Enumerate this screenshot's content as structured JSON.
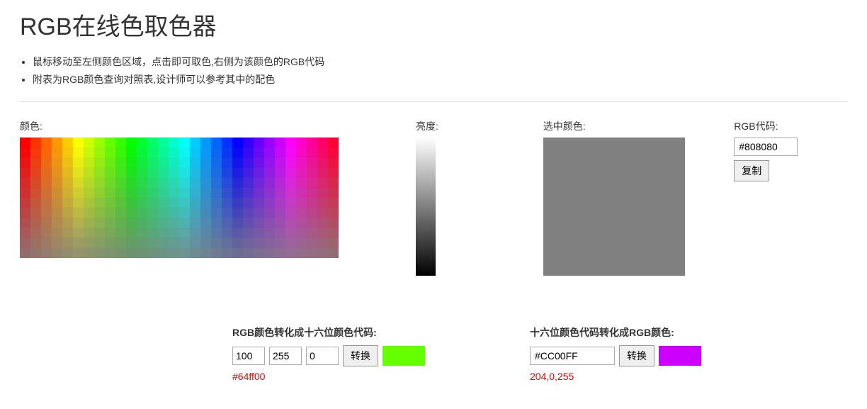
{
  "page": {
    "title": "RGB在线色取色器"
  },
  "notes": [
    "鼠标移动至左侧颜色区域，点击即可取色,右侧为该颜色的RGB代码",
    "附表为RGB颜色查询对照表,设计师可以参考其中的配色"
  ],
  "picker": {
    "color_label": "颜色:",
    "brightness_label": "亮度:",
    "selected_label": "选中颜色:",
    "code_label": "RGB代码:",
    "selected_color": "#808080",
    "code_value": "#808080",
    "copy_label": "复制"
  },
  "rgb2hex": {
    "title": "RGB颜色转化成十六位颜色代码:",
    "r": "100",
    "g": "255",
    "b": "0",
    "convert_label": "转换",
    "result_hex": "#64ff00",
    "result_color": "#64ff00"
  },
  "hex2rgb": {
    "title": "十六位颜色代码转化成RGB颜色:",
    "hex": "#CC00FF",
    "convert_label": "转换",
    "result_rgb": "204,0,255",
    "result_color": "#CC00FF"
  }
}
